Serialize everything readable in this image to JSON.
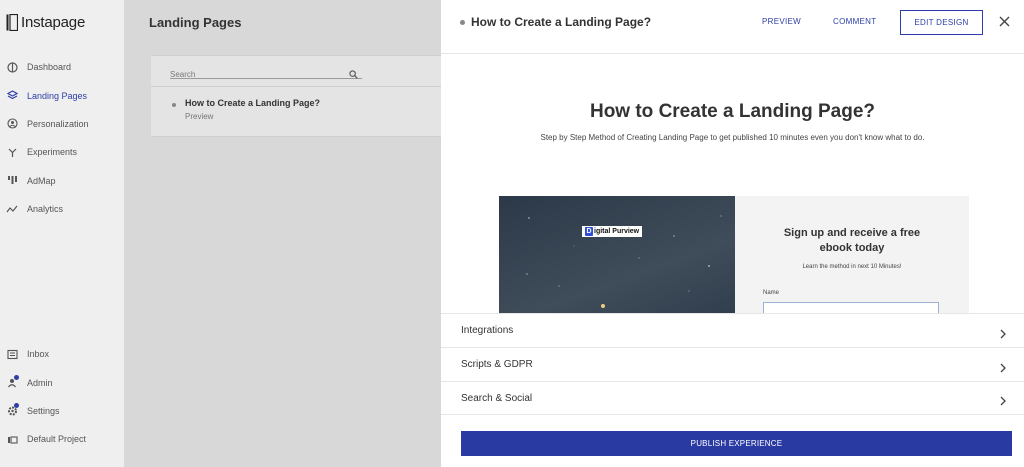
{
  "app": {
    "name": "Instapage"
  },
  "sidebar": {
    "items": [
      {
        "label": "Dashboard",
        "icon": "dashboard-icon"
      },
      {
        "label": "Landing Pages",
        "icon": "layers-icon",
        "active": true
      },
      {
        "label": "Personalization",
        "icon": "personalization-icon"
      },
      {
        "label": "Experiments",
        "icon": "experiments-icon"
      },
      {
        "label": "AdMap",
        "icon": "admap-icon"
      },
      {
        "label": "Analytics",
        "icon": "analytics-icon"
      }
    ],
    "bottom_items": [
      {
        "label": "Inbox",
        "icon": "inbox-icon"
      },
      {
        "label": "Admin",
        "icon": "admin-icon",
        "notification": true
      },
      {
        "label": "Settings",
        "icon": "settings-icon",
        "notification": true
      },
      {
        "label": "Default Project",
        "icon": "project-icon"
      }
    ]
  },
  "middle": {
    "title": "Landing Pages",
    "search": {
      "placeholder": "Search",
      "value": ""
    },
    "list": [
      {
        "title": "How to Create a Landing Page?",
        "subtitle": "Preview"
      }
    ]
  },
  "panel": {
    "title": "How to Create a Landing Page?",
    "actions": {
      "preview": "PREVIEW",
      "comment": "COMMENT",
      "edit_design": "EDIT DESIGN"
    },
    "preview": {
      "heading": "How to Create a Landing Page?",
      "subheading": "Step by Step Method of Creating Landing Page to get published 10 minutes even you don't know what to do.",
      "brand_letter": "D",
      "brand_text": "igital Purview",
      "form_heading_1": "Sign up and receive a free",
      "form_heading_2": "ebook today",
      "form_sub": "Learn the method in next 10 Minutes!",
      "form_label": "Name"
    },
    "sections": [
      "Integrations",
      "Scripts & GDPR",
      "Search & Social"
    ],
    "publish_label": "PUBLISH EXPERIENCE"
  },
  "colors": {
    "accent": "#2d3ea8",
    "publish": "#2a3aa3",
    "sidebar_bg": "#efefef",
    "overlay_bg": "#d8d8d8"
  }
}
